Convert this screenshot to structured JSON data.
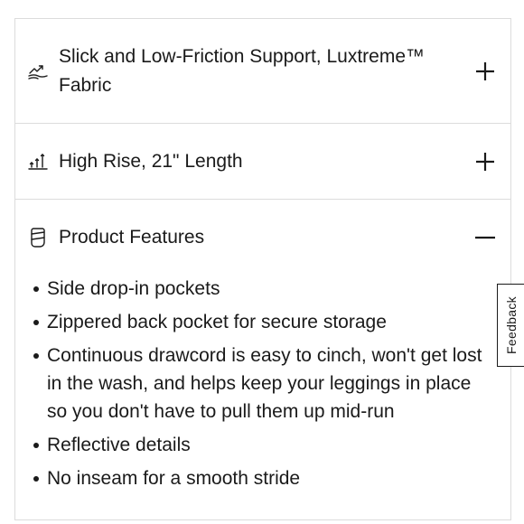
{
  "accordion": {
    "items": [
      {
        "icon": "low-friction-icon",
        "title": "Slick and Low-Friction Support, Luxtreme™ Fabric",
        "toggle": "+",
        "expanded": false
      },
      {
        "icon": "high-rise-icon",
        "title": "High Rise, 21\" Length",
        "toggle": "+",
        "expanded": false
      },
      {
        "icon": "product-features-icon",
        "title": "Product Features",
        "toggle": "−",
        "expanded": true,
        "features": [
          "Side drop-in pockets",
          "Zippered back pocket for secure storage",
          "Continuous drawcord is easy to cinch, won't get lost in the wash, and helps keep your leggings in place so you don't have to pull them up mid-run",
          "Reflective details",
          "No inseam for a smooth stride"
        ]
      }
    ]
  },
  "feedback": {
    "label": "Feedback"
  },
  "colors": {
    "text": "#1a1a1a",
    "border": "#dcdcdc",
    "background": "#ffffff"
  }
}
